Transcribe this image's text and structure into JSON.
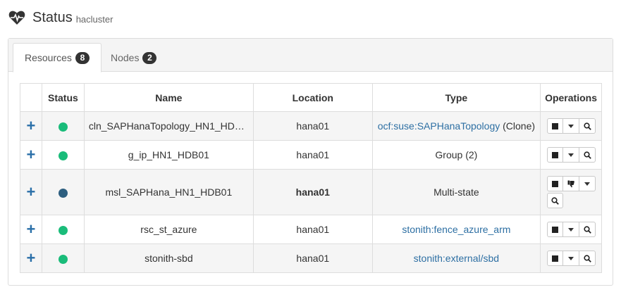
{
  "header": {
    "title": "Status",
    "cluster": "hacluster",
    "icon": "heartbeat-icon"
  },
  "tabs": [
    {
      "label": "Resources",
      "count": "8",
      "active": true
    },
    {
      "label": "Nodes",
      "count": "2",
      "active": false
    }
  ],
  "table": {
    "columns": [
      "",
      "Status",
      "Name",
      "Location",
      "Type",
      "Operations"
    ],
    "rows": [
      {
        "name": "cln_SAPHanaTopology_HN1_HDB...",
        "location": "hana01",
        "location_bold": false,
        "type_link": "ocf:suse:SAPHanaTopology",
        "type_text": " (Clone)",
        "status_color": "#1abc7a",
        "ops": "stop-menu-details"
      },
      {
        "name": "g_ip_HN1_HDB01",
        "location": "hana01",
        "location_bold": false,
        "type_link": "",
        "type_text": "Group (2)",
        "status_color": "#1abc7a",
        "ops": "stop-menu-details"
      },
      {
        "name": "msl_SAPHana_HN1_HDB01",
        "location": "hana01",
        "location_bold": true,
        "type_link": "",
        "type_text": "Multi-state",
        "status_color": "#2e5f80",
        "ops": "stop-demote-menu-details"
      },
      {
        "name": "rsc_st_azure",
        "location": "hana01",
        "location_bold": false,
        "type_link": "stonith:fence_azure_arm",
        "type_text": "",
        "status_color": "#1abc7a",
        "ops": "stop-menu-details"
      },
      {
        "name": "stonith-sbd",
        "location": "hana01",
        "location_bold": false,
        "type_link": "stonith:external/sbd",
        "type_text": "",
        "status_color": "#1abc7a",
        "ops": "stop-menu-details"
      }
    ],
    "row_actions": {
      "expand_symbol": "+",
      "stop_icon": "stop-square-icon",
      "menu_icon": "caret-down-icon",
      "details_icon": "magnifier-icon",
      "demote_icon": "thumbs-down-icon"
    }
  },
  "colors": {
    "link": "#2d6fa3",
    "badge": "#333333",
    "status_ok": "#1abc7a",
    "status_master": "#2e5f80"
  }
}
